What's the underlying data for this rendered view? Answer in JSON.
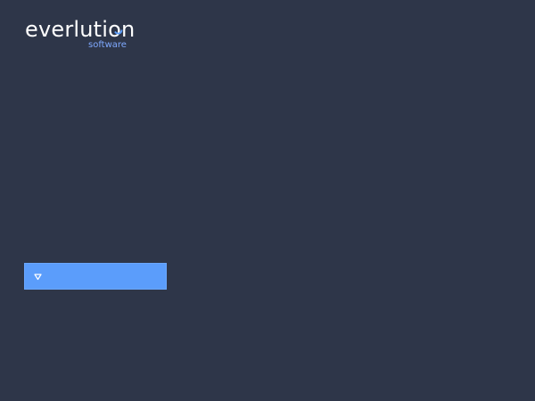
{
  "logo": {
    "name": "everlution",
    "tagline": "software",
    "colors": {
      "name": "#ffffff",
      "tagline": "#7fa9ff",
      "accent": "#5b9dfb"
    }
  },
  "selector": {
    "icon": "caret-down-triangle-icon",
    "value": "",
    "color": "#5b9dfb"
  },
  "background_color": "#2e3649"
}
